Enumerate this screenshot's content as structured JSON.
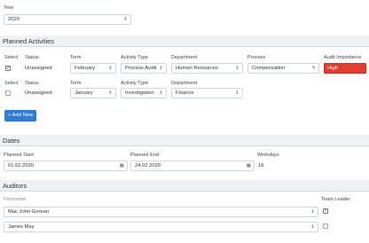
{
  "year": {
    "label": "Year",
    "value": "2020"
  },
  "planned_activities": {
    "title": "Planned Activities",
    "headers": {
      "select": "Select",
      "status": "Status",
      "term": "Term",
      "activity_type": "Activity Type",
      "department": "Department",
      "process": "Process",
      "audit_importance": "Audit Importance"
    },
    "rows": [
      {
        "selected": true,
        "status": "Unassigned",
        "term": "February",
        "activity_type": "Process Audit",
        "department": "Human Resources",
        "process": "Compensation",
        "audit_importance": "High"
      },
      {
        "selected": false,
        "status": "Unassigned",
        "term": "January",
        "activity_type": "Investigation",
        "department": "Finance"
      }
    ],
    "add_new_label": "+ Add New"
  },
  "dates": {
    "title": "Dates",
    "planned_start_label": "Planned Start",
    "planned_start_value": "01.02.2020",
    "planned_end_label": "Planned End",
    "planned_end_value": "24.02.2020",
    "workdays_label": "Workdays",
    "workdays_value": "16"
  },
  "auditors": {
    "title": "Auditors",
    "personnel_label": "Personnel",
    "team_leader_label": "Team Leader",
    "rows": [
      {
        "name": "Mac John Gorean",
        "team_leader": true
      },
      {
        "name": "James May",
        "team_leader": false
      }
    ]
  },
  "icons": {
    "caret": "up-down-caret",
    "calendar": "calendar-icon",
    "edit": "pencil-icon",
    "check": "checkmark"
  }
}
